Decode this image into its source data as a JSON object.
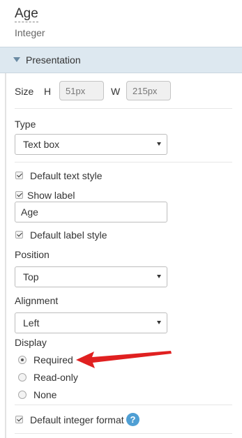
{
  "header": {
    "title": "Age",
    "subtitle": "Integer"
  },
  "section": {
    "label": "Presentation"
  },
  "size": {
    "label": "Size",
    "h_label": "H",
    "h_value": "51px",
    "w_label": "W",
    "w_value": "215px"
  },
  "type": {
    "label": "Type",
    "value": "Text box"
  },
  "checkboxes": {
    "default_text_style": "Default text style",
    "show_label": "Show label",
    "default_label_style": "Default label style",
    "default_integer_format": "Default integer format"
  },
  "label_input": {
    "value": "Age"
  },
  "position": {
    "label": "Position",
    "value": "Top"
  },
  "alignment": {
    "label": "Alignment",
    "value": "Left"
  },
  "display": {
    "label": "Display",
    "options": [
      "Required",
      "Read-only",
      "None"
    ],
    "selected": "Required"
  },
  "help_glyph": "?",
  "colors": {
    "section_bar": "#dde8f0",
    "help_icon": "#4f9fd4",
    "annotation_arrow": "#e02020"
  }
}
